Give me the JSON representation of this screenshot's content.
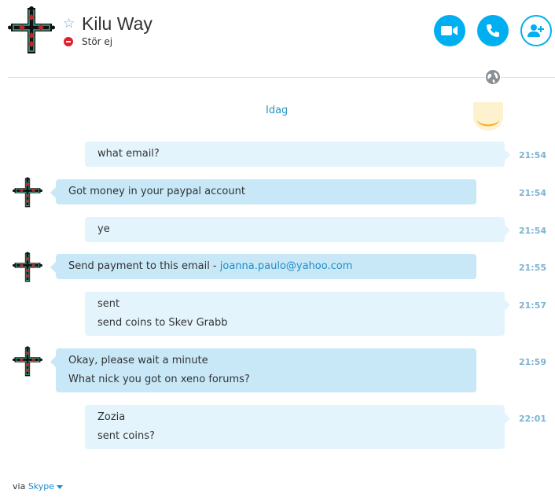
{
  "contact": {
    "name": "Kilu Way",
    "status": "Stör ej",
    "status_color": "#e0202e",
    "avatar_icon": "cross-icon"
  },
  "header_actions": [
    {
      "name": "video-call",
      "icon": "video-camera-icon"
    },
    {
      "name": "audio-call",
      "icon": "phone-icon"
    },
    {
      "name": "add-contact",
      "icon": "add-person-icon"
    }
  ],
  "chat": {
    "day_label": "Idag",
    "messages": [
      {
        "direction": "out",
        "lines": [
          "what email?"
        ],
        "time": "21:54"
      },
      {
        "direction": "in",
        "lines": [
          "Got money in your paypal account"
        ],
        "time": "21:54"
      },
      {
        "direction": "out",
        "lines": [
          "ye"
        ],
        "time": "21:54"
      },
      {
        "direction": "in",
        "text": "Send payment to this email - ",
        "link": "joanna.paulo@yahoo.com",
        "time": "21:55"
      },
      {
        "direction": "out",
        "lines": [
          "sent",
          "send coins to Skev Grabb"
        ],
        "time": "21:57"
      },
      {
        "direction": "in",
        "lines": [
          "Okay, please wait a minute",
          "What nick you got on xeno forums?"
        ],
        "time": "21:59"
      },
      {
        "direction": "out",
        "lines": [
          "Zozia",
          "sent coins?"
        ],
        "time": "22:01"
      }
    ]
  },
  "footer": {
    "via": "via",
    "brand": "Skype"
  },
  "colors": {
    "accent": "#00aff0",
    "bubble_out": "#e4f4fc",
    "bubble_in": "#c8e8f8",
    "link": "#1e8ccc"
  }
}
